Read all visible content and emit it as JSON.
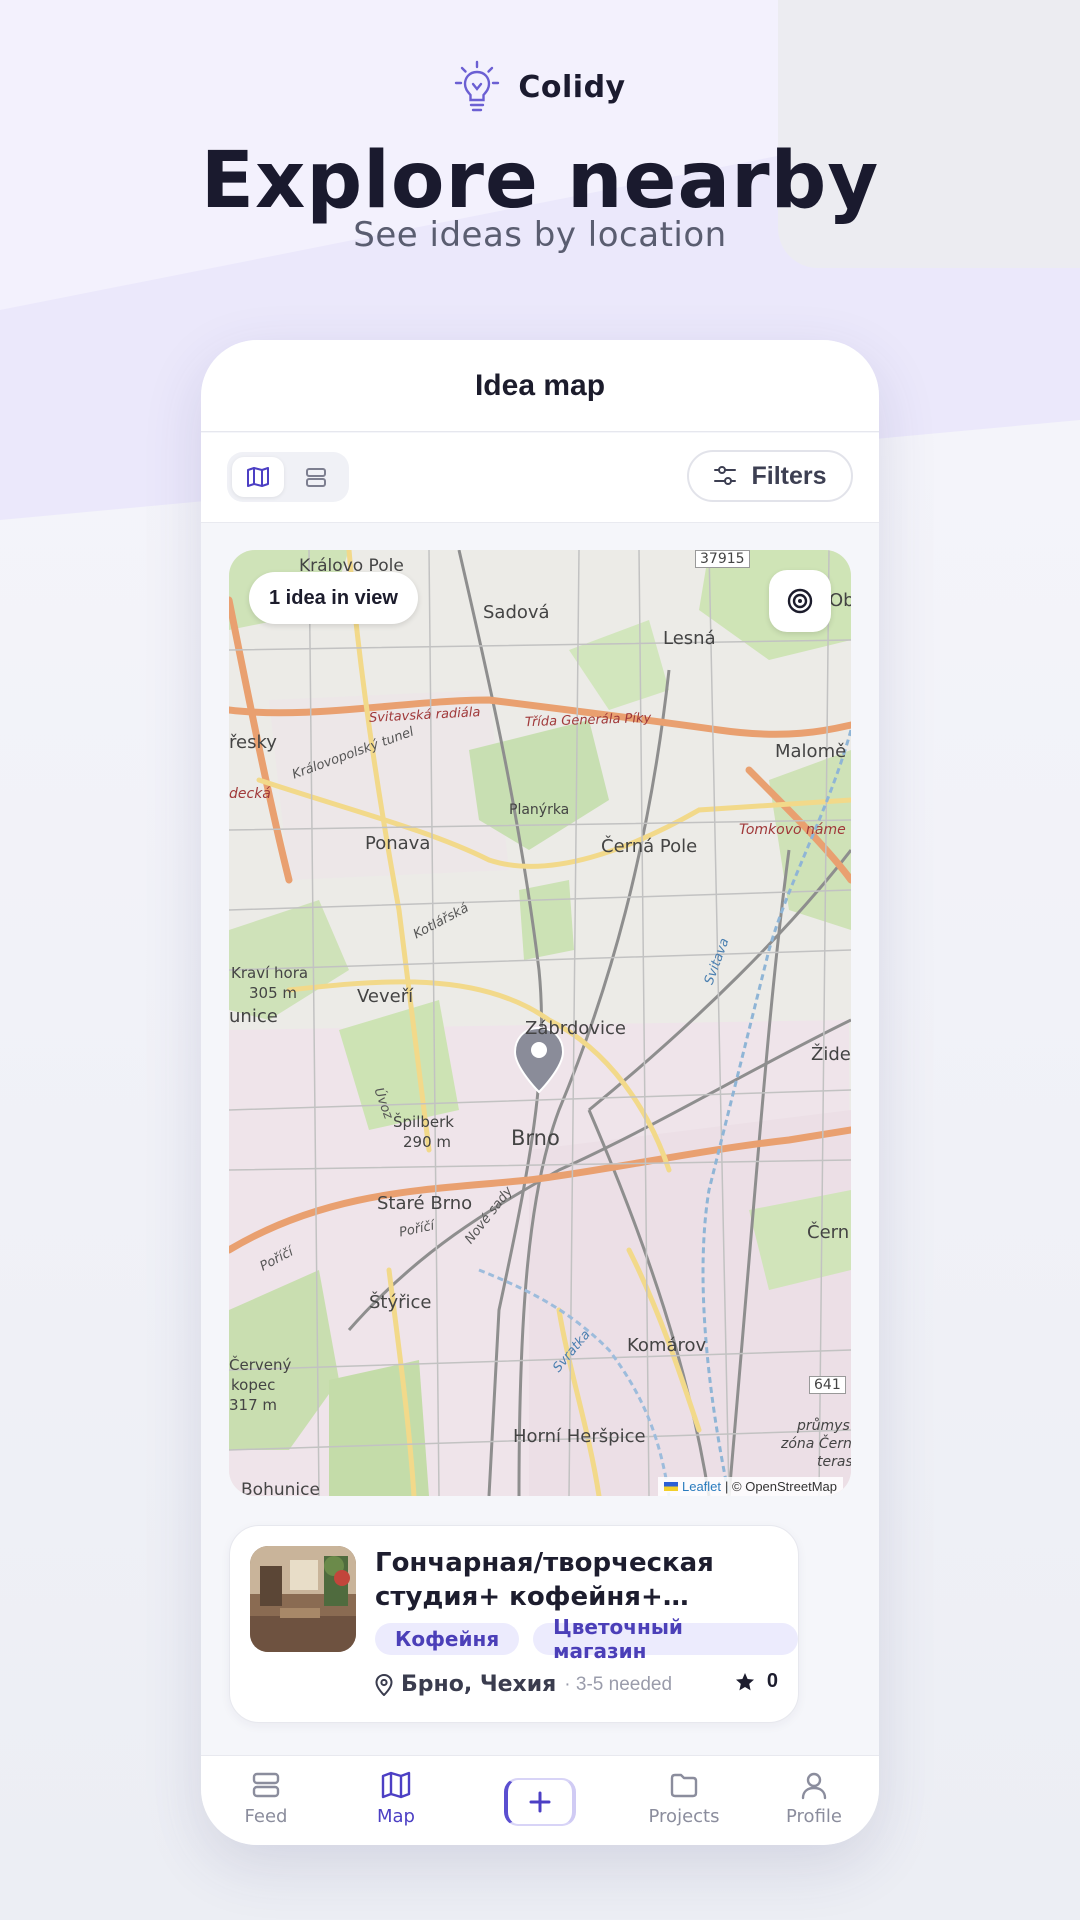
{
  "brand": {
    "name": "Colidy",
    "logo_icon": "lightbulb-icon"
  },
  "hero": {
    "title": "Explore nearby",
    "subtitle": "See ideas by location"
  },
  "screen": {
    "title": "Idea map",
    "view_toggle": {
      "options": [
        "map-view-icon",
        "list-view-icon"
      ],
      "selected": "map-view-icon"
    },
    "filters_label": "Filters"
  },
  "map": {
    "count_label": "1 idea in view",
    "attribution_leaflet": "Leaflet",
    "attribution_rest": "| © OpenStreetMap",
    "labels": {
      "kralovo_pole": "Královo Pole",
      "sadova": "Sadová",
      "lesna": "Lesná",
      "maloměřice": "Malomě",
      "ob": "Ob",
      "presky": "řesky",
      "decka": "decká",
      "ponava": "Ponava",
      "planyrka": "Planýrka",
      "cerna_pole": "Černá Pole",
      "tomkovo": "Tomkovo náme",
      "kravi_hora": "Kraví hora",
      "kravi_hora_alt": "305 m",
      "unice": "unice",
      "veveri": "Veveří",
      "zabrdovice": "Zábrdovice",
      "zide": "Žide",
      "spilberk": "Špilberk",
      "spilberk_alt": "290 m",
      "brno": "Brno",
      "stare_brno": "Staré Brno",
      "cern": "Čern",
      "styrice": "Štýřice",
      "komarov": "Komárov",
      "cerveny_kopec": "Červený",
      "cerveny_kopec_2": "kopec",
      "cerveny_kopec_alt": "317 m",
      "horni_herspice": "Horní Heršpice",
      "bohunice": "Bohunice",
      "prumysl": "průmys",
      "zona": "zóna Čern",
      "teras": "teras",
      "road_svitavska": "Svitavská radiála",
      "road_generala": "Třída Generála Píky",
      "road_kralovopolsky": "Královopolský tunel",
      "road_kotlarska": "Kotlářská",
      "road_porici": "Poříčí",
      "road_nove_sady": "Nové sady",
      "road_uvoz": "Úvoz",
      "road_svitava": "Svitava",
      "road_svratka": "Svratka",
      "road_37915": "37915",
      "road_641": "641"
    }
  },
  "idea_card": {
    "title": "Гончарная/творческая студия+ кофейня+ цветочный магазин",
    "tags": [
      "Кофейня",
      "Цветочный магазин"
    ],
    "location": "Брно, Чехия",
    "needed": "· 3-5 needed",
    "rating": "0"
  },
  "nav": {
    "items": [
      {
        "label": "Feed",
        "icon": "feed-icon"
      },
      {
        "label": "Map",
        "icon": "map-icon"
      },
      {
        "label": "",
        "icon": "plus-icon"
      },
      {
        "label": "Projects",
        "icon": "folder-icon"
      },
      {
        "label": "Profile",
        "icon": "profile-icon"
      }
    ],
    "active": "Map"
  },
  "colors": {
    "accent": "#4c3fc4",
    "tag_bg": "#ecebfd",
    "marker": "#8a8c99"
  }
}
